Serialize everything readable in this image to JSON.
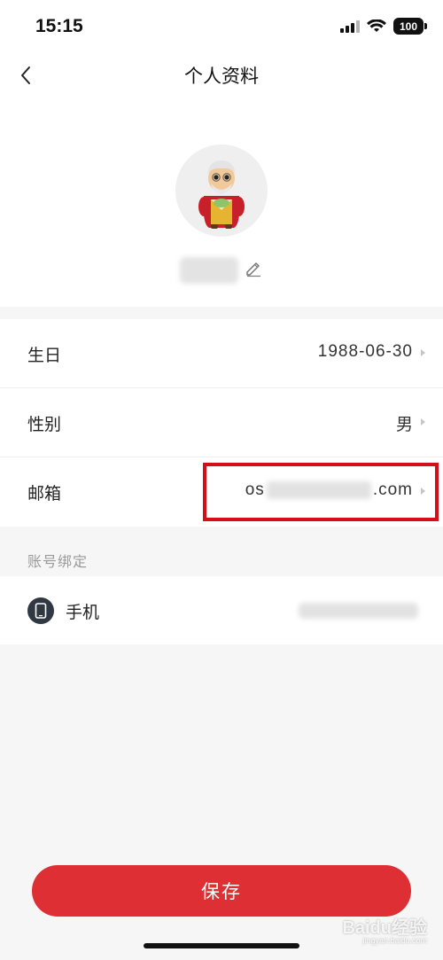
{
  "status_bar": {
    "time": "15:15",
    "battery": "100"
  },
  "nav": {
    "title": "个人资料"
  },
  "profile": {},
  "info": {
    "birthday": {
      "label": "生日",
      "value": "1988-06-30"
    },
    "gender": {
      "label": "性别",
      "value": "男"
    },
    "email": {
      "label": "邮箱",
      "prefix": "os",
      "suffix": ".com"
    }
  },
  "account_binding": {
    "title": "账号绑定",
    "phone": {
      "label": "手机"
    }
  },
  "save_button": {
    "label": "保存"
  },
  "watermark": {
    "text": "Baidu经验",
    "sub": "jingyan.baidu.com"
  },
  "colors": {
    "accent": "#dd2f34",
    "highlight": "#d50f18",
    "background": "#f6f6f6"
  },
  "icons": [
    "signal-icon",
    "wifi-icon",
    "battery-icon",
    "back-chevron-icon",
    "avatar-icon",
    "pencil-edit-icon",
    "chevron-right-icon",
    "phone-icon"
  ]
}
